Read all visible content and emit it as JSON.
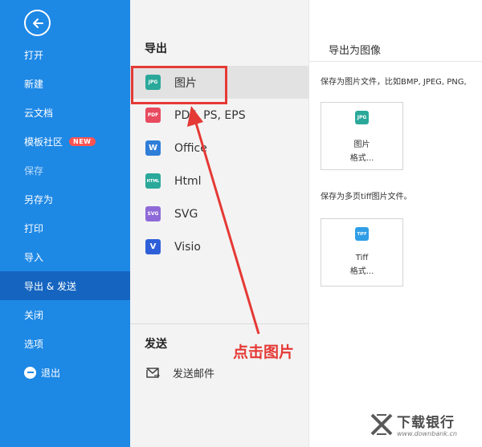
{
  "sidebar": {
    "items": [
      {
        "label": "打开"
      },
      {
        "label": "新建"
      },
      {
        "label": "云文档"
      },
      {
        "label": "模板社区",
        "badge": "NEW"
      },
      {
        "label": "保存"
      },
      {
        "label": "另存为"
      },
      {
        "label": "打印"
      },
      {
        "label": "导入"
      },
      {
        "label": "导出 & 发送"
      },
      {
        "label": "关闭"
      },
      {
        "label": "选项"
      },
      {
        "label": "退出"
      }
    ]
  },
  "export_panel": {
    "title": "导出",
    "items": [
      {
        "label": "图片",
        "icon_text": "JPG",
        "color": "#2aa89a"
      },
      {
        "label": "PDF, PS, EPS",
        "icon_text": "PDF",
        "color": "#e84a5f"
      },
      {
        "label": "Office",
        "icon_text": "W",
        "color": "#2f7ed8"
      },
      {
        "label": "Html",
        "icon_text": "HTML",
        "color": "#2aa89a"
      },
      {
        "label": "SVG",
        "icon_text": "SVG",
        "color": "#8e6ad8"
      },
      {
        "label": "Visio",
        "icon_text": "V",
        "color": "#2f5fd8"
      }
    ],
    "send_title": "发送",
    "send_item": "发送邮件"
  },
  "image_panel": {
    "title": "导出为图像",
    "desc1": "保存为图片文件，比如BMP, JPEG, PNG,",
    "card1": {
      "icon_text": "JPG",
      "label": "图片",
      "sub": "格式..."
    },
    "desc2": "保存为多页tiff图片文件。",
    "card2": {
      "icon_text": "TIFF",
      "label": "Tiff",
      "sub": "格式..."
    }
  },
  "annotation": {
    "text": "点击图片"
  },
  "watermark": {
    "text": "下载银行",
    "url": "www.downbank.cn"
  },
  "colors": {
    "accent": "#1e88e5",
    "annotation": "#e53935"
  }
}
